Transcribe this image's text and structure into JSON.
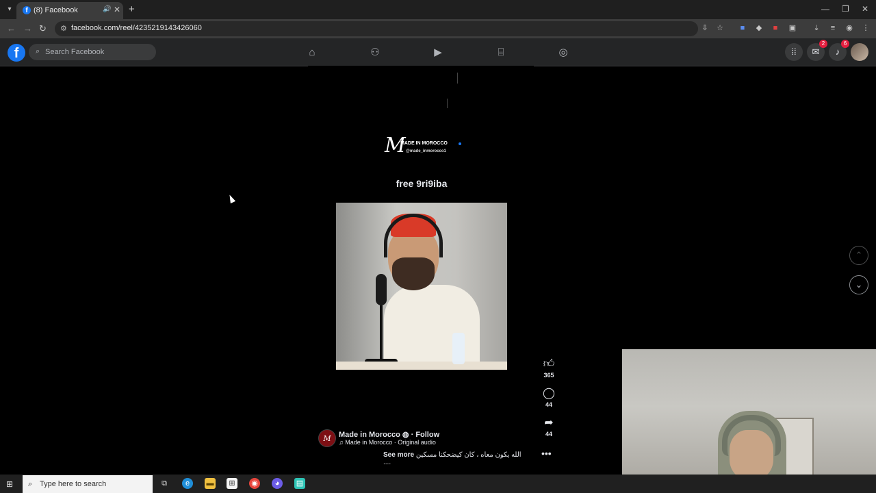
{
  "browser": {
    "tab_title": "(8) Facebook",
    "url": "facebook.com/reel/4235219143426060"
  },
  "facebook": {
    "search_placeholder": "Search Facebook",
    "messenger_badge": "2",
    "notifications_badge": "6"
  },
  "reel": {
    "brand_name": "MADE IN MOROCCO",
    "brand_handle": "@made_inmorocco1",
    "caption": "free 9ri9iba",
    "likes": "365",
    "comments": "44",
    "shares": "44",
    "author": "Made in Morocco",
    "follow_label": "Follow",
    "audio": "Made in Morocco · Original audio",
    "description": "الله يكون معاه ، كان كيضحكنا مسكين ....",
    "see_more": "See more"
  },
  "taskbar": {
    "search_placeholder": "Type here to search"
  },
  "colors": {
    "fb_blue": "#1877f2",
    "header_bg": "#242526",
    "badge_red": "#e41e3f"
  }
}
